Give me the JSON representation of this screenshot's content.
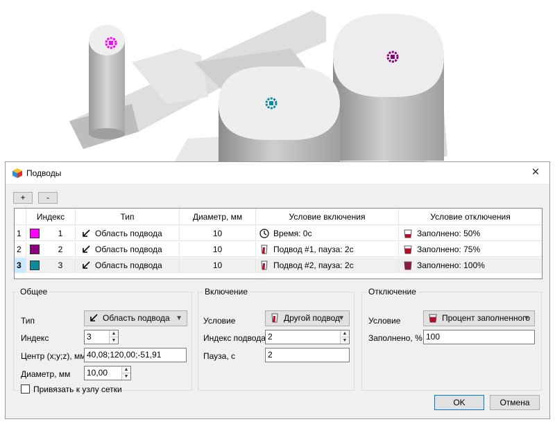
{
  "dialog": {
    "title": "Подводы"
  },
  "toolbar": {
    "add_label": "+",
    "remove_label": "-"
  },
  "table": {
    "headers": [
      "Индекс",
      "Тип",
      "Диаметр, мм",
      "Условие включения",
      "Условие отключения"
    ],
    "rows": [
      {
        "num": "1",
        "color": "#ff00ff",
        "index": "1",
        "type": "Область подвода",
        "diameter": "10",
        "on_condition": "Время: 0с",
        "off_condition": "Заполнено: 50%"
      },
      {
        "num": "2",
        "color": "#8b007a",
        "index": "2",
        "type": "Область подвода",
        "diameter": "10",
        "on_condition": "Подвод #1, пауза: 2с",
        "off_condition": "Заполнено: 75%"
      },
      {
        "num": "3",
        "color": "#0f8a9a",
        "index": "3",
        "type": "Область подвода",
        "diameter": "10",
        "on_condition": "Подвод #2, пауза: 2с",
        "off_condition": "Заполнено: 100%"
      }
    ],
    "selected_row": 3
  },
  "general": {
    "legend": "Общее",
    "type_label": "Тип",
    "type_value": "Область подвода",
    "index_label": "Индекс",
    "index_value": "3",
    "center_label": "Центр (x;y;z), мм",
    "center_value": "40,08;120,00;-51,91",
    "diameter_label": "Диаметр, мм",
    "diameter_value": "10,00",
    "snap_label": "Привязать к узлу сетки",
    "snap_checked": false
  },
  "enable": {
    "legend": "Включение",
    "condition_label": "Условие",
    "condition_value": "Другой подвод",
    "gate_index_label": "Индекс подвода",
    "gate_index_value": "2",
    "pause_label": "Пауза, с",
    "pause_value": "2"
  },
  "disable": {
    "legend": "Отключение",
    "condition_label": "Условие",
    "condition_value": "Процент заполненного",
    "filled_label": "Заполнено, %",
    "filled_value": "100"
  },
  "buttons": {
    "ok": "OK",
    "cancel": "Отмена"
  },
  "colors": {
    "accent": "#0078d7",
    "gate1": "#ff00ff",
    "gate2": "#8b007a",
    "gate3": "#0f8a9a",
    "cup": "#b0102a"
  }
}
